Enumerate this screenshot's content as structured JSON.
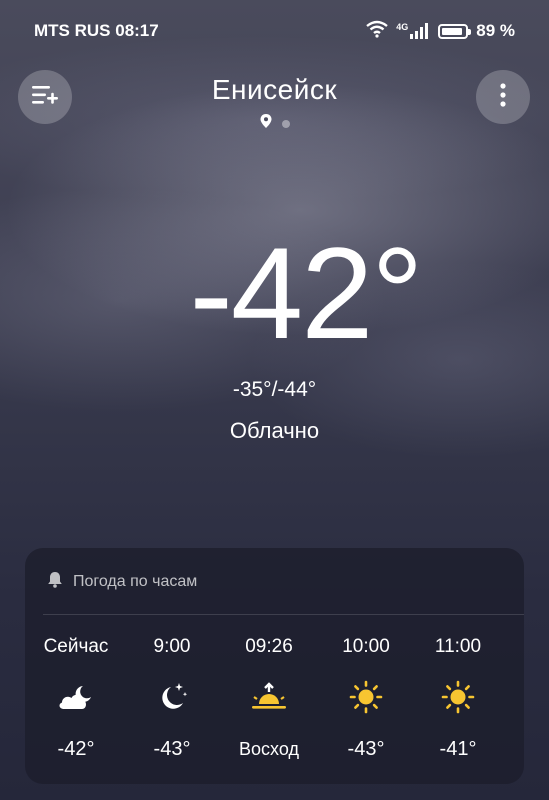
{
  "status": {
    "carrier": "MTS RUS",
    "time": "08:17",
    "network": "4G",
    "battery": "89 %",
    "battery_level": 0.89
  },
  "header": {
    "city": "Енисейск",
    "pages": 2,
    "active_page": 0
  },
  "current": {
    "temperature": "-42°",
    "range": "-35°/-44°",
    "condition": "Облачно"
  },
  "hourly": {
    "title": "Погода по часам",
    "items": [
      {
        "time": "Сейчас",
        "icon": "cloud-moon-icon",
        "temp": "-42°"
      },
      {
        "time": "9:00",
        "icon": "moon-stars-icon",
        "temp": "-43°"
      },
      {
        "time": "09:26",
        "icon": "sunrise-icon",
        "temp": "Восход"
      },
      {
        "time": "10:00",
        "icon": "sun-icon",
        "temp": "-43°"
      },
      {
        "time": "11:00",
        "icon": "sun-icon",
        "temp": "-41°"
      }
    ]
  },
  "colors": {
    "sun": "#f7c531",
    "accent_white": "#ffffff"
  }
}
